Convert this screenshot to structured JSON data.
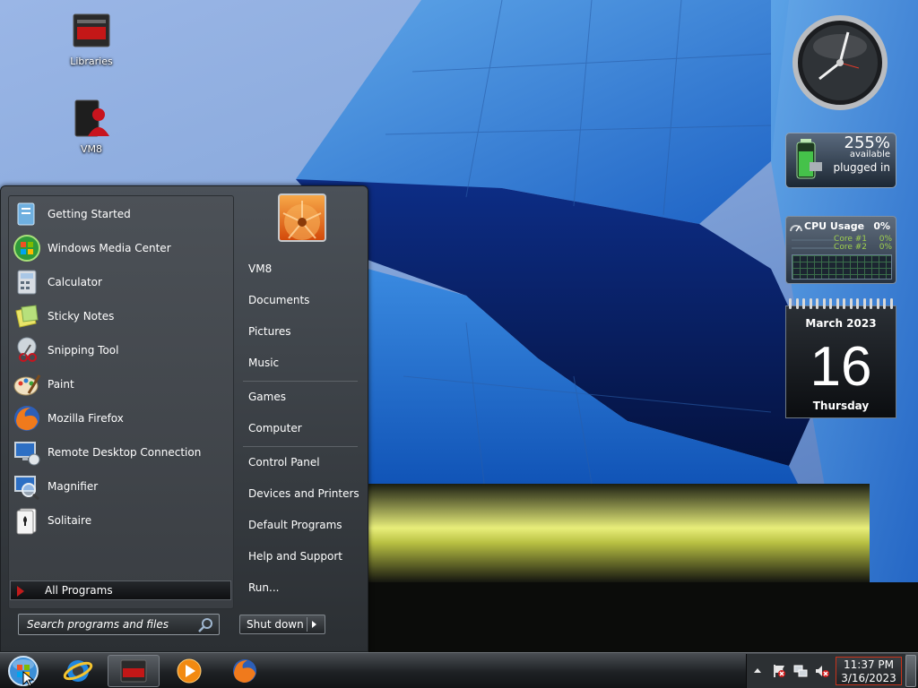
{
  "desktop": {
    "icons": [
      {
        "label": "Libraries",
        "icon": "libraries-icon"
      },
      {
        "label": "VM8",
        "icon": "user-folder-icon"
      }
    ]
  },
  "gadgets": {
    "battery": {
      "percent": "255%",
      "status": "available",
      "power": "plugged in"
    },
    "cpu": {
      "title": "CPU Usage",
      "total": "0%",
      "cores": [
        {
          "label": "Core #1",
          "value": "0%"
        },
        {
          "label": "Core #2",
          "value": "0%"
        }
      ]
    },
    "calendar": {
      "month": "March 2023",
      "day": "16",
      "weekday": "Thursday"
    }
  },
  "start_menu": {
    "programs": [
      {
        "label": "Getting Started",
        "icon": "getting-started-icon"
      },
      {
        "label": "Windows Media Center",
        "icon": "media-center-icon"
      },
      {
        "label": "Calculator",
        "icon": "calculator-icon"
      },
      {
        "label": "Sticky Notes",
        "icon": "sticky-notes-icon"
      },
      {
        "label": "Snipping Tool",
        "icon": "snipping-tool-icon"
      },
      {
        "label": "Paint",
        "icon": "paint-icon"
      },
      {
        "label": "Mozilla Firefox",
        "icon": "firefox-icon"
      },
      {
        "label": "Remote Desktop Connection",
        "icon": "remote-desktop-icon"
      },
      {
        "label": "Magnifier",
        "icon": "magnifier-icon"
      },
      {
        "label": "Solitaire",
        "icon": "solitaire-icon"
      }
    ],
    "all_programs": "All Programs",
    "search_placeholder": "Search programs and files",
    "places": [
      {
        "label": "VM8"
      },
      {
        "label": "Documents"
      },
      {
        "label": "Pictures"
      },
      {
        "label": "Music"
      },
      {
        "label": "Games"
      },
      {
        "label": "Computer"
      },
      {
        "label": "Control Panel"
      },
      {
        "label": "Devices and Printers"
      },
      {
        "label": "Default Programs"
      },
      {
        "label": "Help and Support"
      },
      {
        "label": "Run..."
      }
    ],
    "shutdown": "Shut down"
  },
  "taskbar": {
    "pinned": [
      {
        "icon": "internet-explorer-icon"
      },
      {
        "icon": "libraries-icon"
      },
      {
        "icon": "media-player-icon"
      },
      {
        "icon": "firefox-icon"
      }
    ],
    "clock": {
      "time": "11:37 PM",
      "date": "3/16/2023"
    }
  },
  "colors": {
    "accent": "#c21b1b",
    "text": "#ffffff"
  }
}
